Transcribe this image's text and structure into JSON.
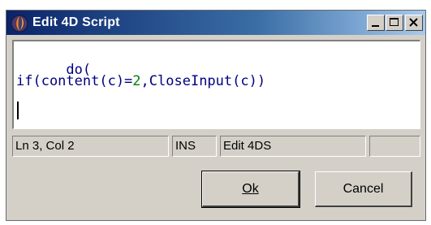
{
  "window": {
    "title": "Edit 4D Script",
    "colors": {
      "title_active": "#0a246a",
      "title_gradient_end": "#a6caf0",
      "face": "#d4d0c8",
      "code": "#00007f",
      "number": "#008000"
    }
  },
  "title_buttons": {
    "minimize_icon": "minimize-icon",
    "maximize_icon": "maximize-icon",
    "close_icon": "close-icon"
  },
  "editor": {
    "line1": "do(",
    "line2": {
      "before": "if(content(c)=",
      "number": "2",
      "after": ",CloseInput(c))"
    }
  },
  "statusbar": {
    "position": "Ln 3, Col 2",
    "mode": "INS",
    "info": "Edit 4DS",
    "extra": ""
  },
  "buttons": {
    "ok_label": "Ok",
    "cancel_label": "Cancel"
  }
}
